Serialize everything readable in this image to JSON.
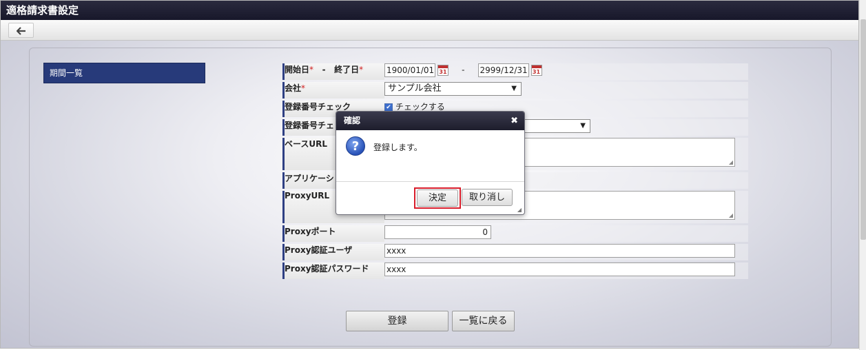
{
  "window": {
    "title": "適格請求書設定"
  },
  "toolbar": {
    "back_icon": "arrow-left"
  },
  "sidebar": {
    "items": [
      {
        "label": "期間一覧"
      }
    ]
  },
  "form": {
    "date_range": {
      "start_label": "開始日",
      "sep": "-",
      "end_label": "終了日",
      "required_mark": "*",
      "start_value": "1900/01/01",
      "end_value": "2999/12/31",
      "cal_icon_text": "31"
    },
    "company": {
      "label": "会社",
      "value": "サンプル会社"
    },
    "reg_check": {
      "label": "登録番号チェック",
      "checkbox_label": "チェックする"
    },
    "reg_check2": {
      "label": "登録番号チェ"
    },
    "base_url": {
      "label": "ベースURL"
    },
    "application": {
      "label": "アプリケーシ"
    },
    "proxy_url": {
      "label": "ProxyURL"
    },
    "proxy_port": {
      "label": "Proxyポート",
      "value": "0"
    },
    "proxy_user": {
      "label": "Proxy認証ユーザ",
      "value": "xxxx"
    },
    "proxy_password": {
      "label": "Proxy認証パスワード",
      "value": "xxxx"
    }
  },
  "actions": {
    "register": "登録",
    "back_to_list": "一覧に戻る"
  },
  "dialog": {
    "title": "確認",
    "close": "✖",
    "message": "登録します。",
    "ok": "決定",
    "cancel": "取り消し"
  },
  "colors": {
    "accent": "#273a7a",
    "highlight": "#d81c2a",
    "required": "#d02020"
  }
}
